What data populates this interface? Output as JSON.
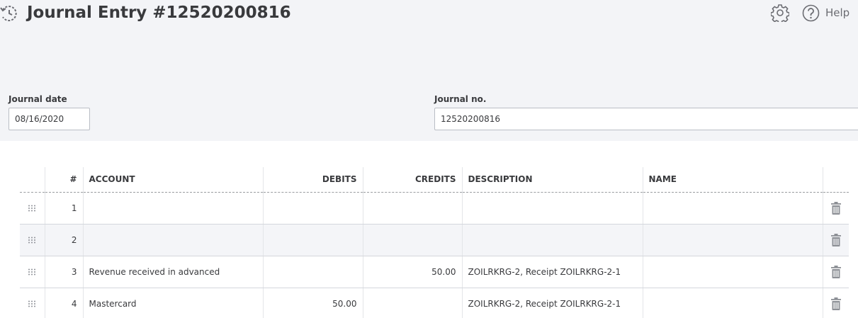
{
  "header": {
    "title": "Journal Entry #12520200816",
    "help_label": "Help"
  },
  "form": {
    "journal_date": {
      "label": "Journal date",
      "value": "08/16/2020"
    },
    "journal_no": {
      "label": "Journal no.",
      "value": "12520200816"
    }
  },
  "table": {
    "columns": {
      "num": "#",
      "account": "ACCOUNT",
      "debits": "DEBITS",
      "credits": "CREDITS",
      "description": "DESCRIPTION",
      "name": "NAME"
    },
    "rows": [
      {
        "num": "1",
        "account": "",
        "debits": "",
        "credits": "",
        "description": "",
        "name": ""
      },
      {
        "num": "2",
        "account": "",
        "debits": "",
        "credits": "",
        "description": "",
        "name": ""
      },
      {
        "num": "3",
        "account": "Revenue received in advanced",
        "debits": "",
        "credits": "50.00",
        "description": "ZOILRKRG-2, Receipt ZOILRKRG-2-1",
        "name": ""
      },
      {
        "num": "4",
        "account": "Mastercard",
        "debits": "50.00",
        "credits": "",
        "description": "ZOILRKRG-2, Receipt ZOILRKRG-2-1",
        "name": ""
      }
    ]
  },
  "icons": {
    "history": "history-icon",
    "settings": "gear-icon",
    "help": "help-circle-icon",
    "drag": "drag-handle-icon",
    "delete": "trash-icon"
  }
}
